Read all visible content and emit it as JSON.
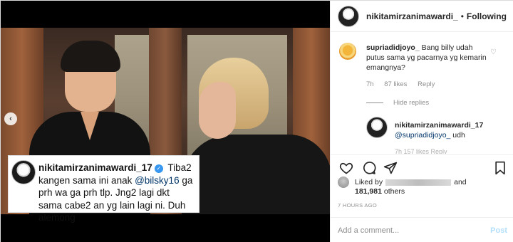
{
  "post": {
    "header": {
      "username": "nikitamirzanimawardi_",
      "separator": "•",
      "follow_label": "Following"
    },
    "caption": {
      "username": "nikitamirzanimawardi_17",
      "text_before": " Tiba2 kangen sama ini anak ",
      "mention": "@bilsky16",
      "text_after": " ga prh wa ga prh tlp. Jng2 lagi dkt sama cabe2 an yg lain lagi ni. Duh alemong"
    },
    "comments": [
      {
        "username": "supriadidjoyo_",
        "text": " Bang billy udah putus sama yg pacarnya yg kemarin emangnya?",
        "time": "7h",
        "likes": "87 likes",
        "reply_label": "Reply",
        "hide_replies_label": "Hide replies"
      }
    ],
    "reply": {
      "username": "nikitamirzanimawardi_17",
      "mention": "@supriadidjoyo_",
      "text": " udh",
      "cut_text": "7h    157 likes    Reply"
    },
    "likes": {
      "liked_by_prefix": "Liked by",
      "and_label": "and",
      "count": "181,981",
      "others_label": "others"
    },
    "timestamp": "7 HOURS AGO",
    "add_comment": {
      "placeholder": "Add a comment...",
      "post_label": "Post"
    },
    "icons": {
      "nav_prev": "‹",
      "verified": "✓",
      "heart_small": "♡"
    },
    "colors": {
      "link_blue": "#003569",
      "verified_blue": "#3897f0",
      "muted": "#8e8e8e",
      "post_disabled": "#b2dffc"
    }
  }
}
